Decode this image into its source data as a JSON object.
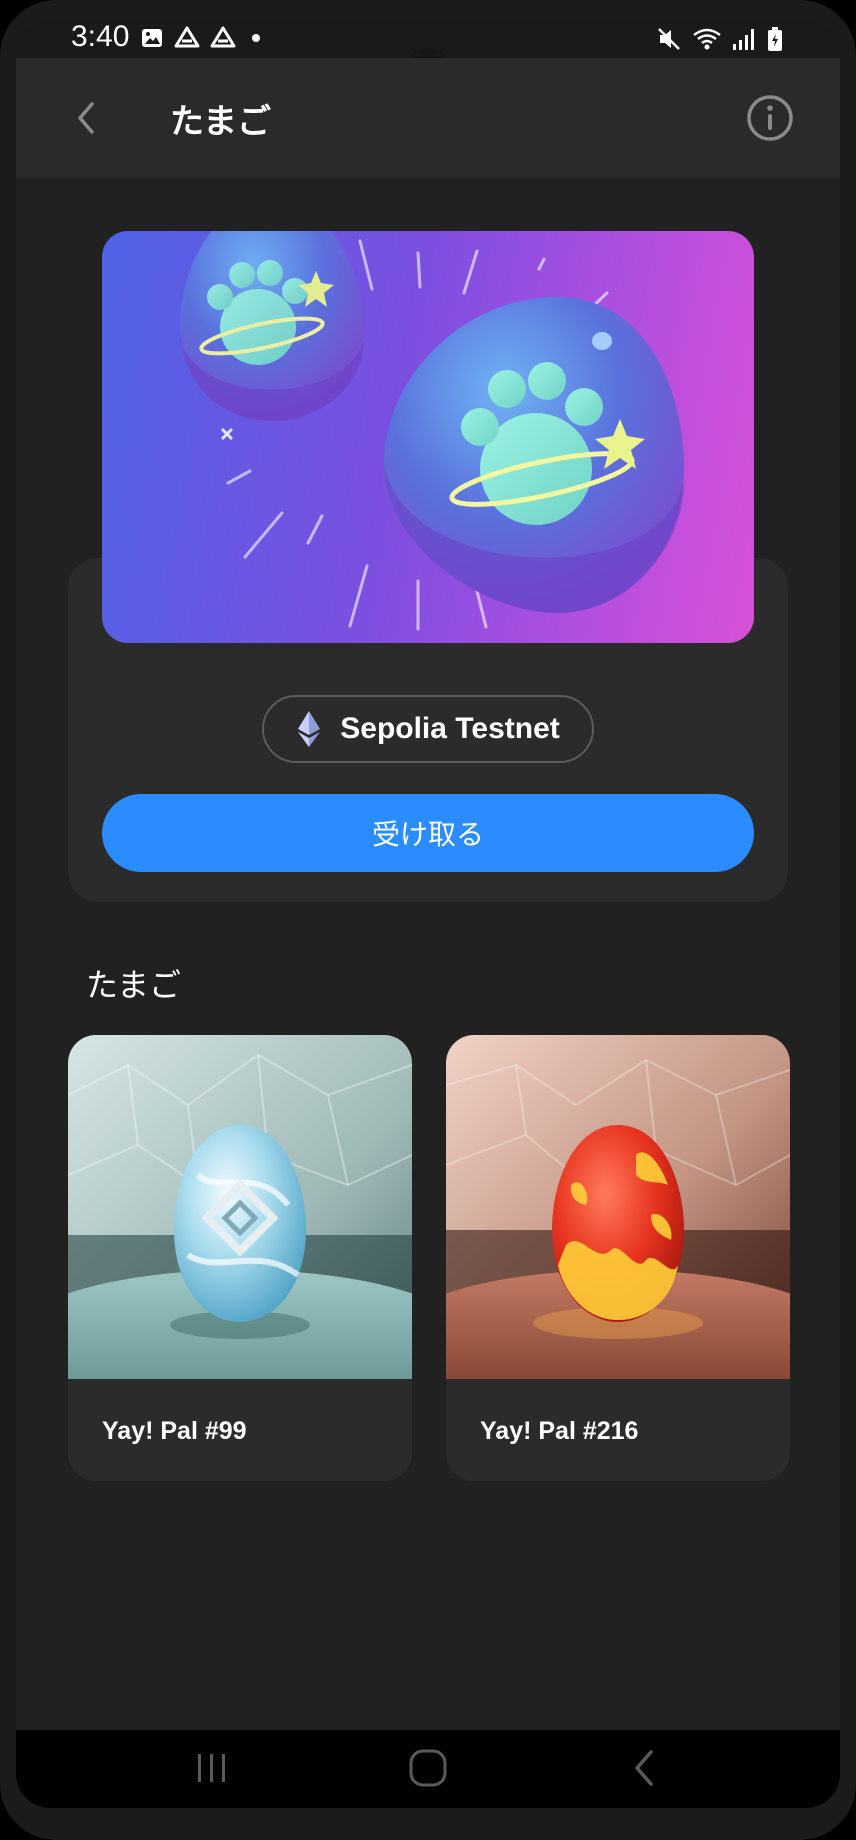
{
  "status_bar": {
    "time": "3:40",
    "left_icons": [
      "image-icon",
      "drive-icon",
      "drive-icon",
      "dot-icon"
    ],
    "right_icons": [
      "mute-icon",
      "wifi-icon",
      "signal-icon",
      "battery-charging-icon"
    ]
  },
  "app_bar": {
    "title": "たまご",
    "back_icon": "chevron-left-icon",
    "info_icon": "info-circle-icon"
  },
  "hero": {
    "network_label": "Sepolia Testnet",
    "network_icon": "ethereum-icon",
    "claim_button_label": "受け取る"
  },
  "section": {
    "title": "たまご"
  },
  "nfts": [
    {
      "name": "Yay! Pal #99",
      "theme": "ice"
    },
    {
      "name": "Yay! Pal #216",
      "theme": "fire"
    }
  ],
  "nav_bar": {
    "buttons": [
      "recents-icon",
      "home-icon",
      "back-icon"
    ]
  },
  "colors": {
    "background": "#212121",
    "card": "#2b2b2b",
    "accent": "#2a8cff",
    "banner_start": "#4f63e6",
    "banner_end": "#d850d6"
  }
}
